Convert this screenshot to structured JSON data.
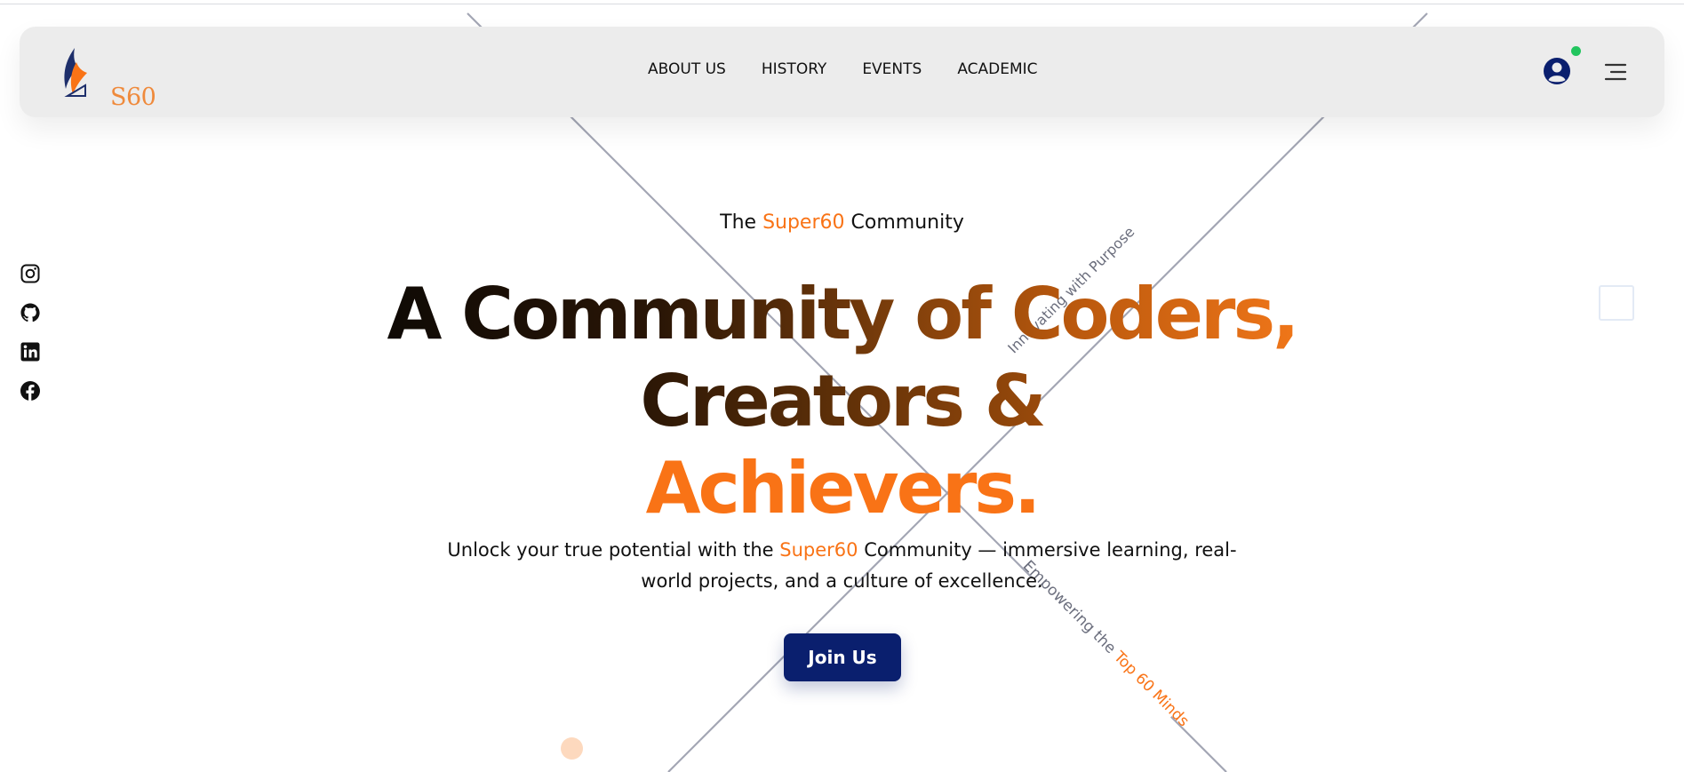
{
  "brand": {
    "logo_text": "S60",
    "logo_icon": "quill-feather-icon",
    "accent_color": "#f97316",
    "primary_color": "#0a1f6e"
  },
  "nav": {
    "links": [
      {
        "label": "ABOUT US"
      },
      {
        "label": "HISTORY"
      },
      {
        "label": "EVENTS"
      },
      {
        "label": "ACADEMIC"
      }
    ],
    "user_icon": "user-circle-icon",
    "status_color": "#22c55e",
    "menu_icon": "hamburger-menu-icon"
  },
  "social": [
    {
      "icon": "instagram-icon"
    },
    {
      "icon": "github-icon"
    },
    {
      "icon": "linkedin-icon"
    },
    {
      "icon": "facebook-icon"
    }
  ],
  "hero": {
    "eyebrow": {
      "prefix": "The ",
      "highlight": "Super60",
      "suffix": " Community"
    },
    "headline": {
      "line1": "A Community of Coders,",
      "line2": "Creators &",
      "line3": "Achievers."
    },
    "subtitle": {
      "prefix": "Unlock your true potential with the ",
      "highlight": "Super60",
      "suffix": " Community — immersive learning, real-world projects, and a culture of excellence."
    },
    "cta_label": "Join Us"
  },
  "diagonal_labels": {
    "upper": "Innovating with Purpose",
    "lower_prefix": "Empowering the ",
    "lower_highlight": "Top 60 Minds"
  }
}
